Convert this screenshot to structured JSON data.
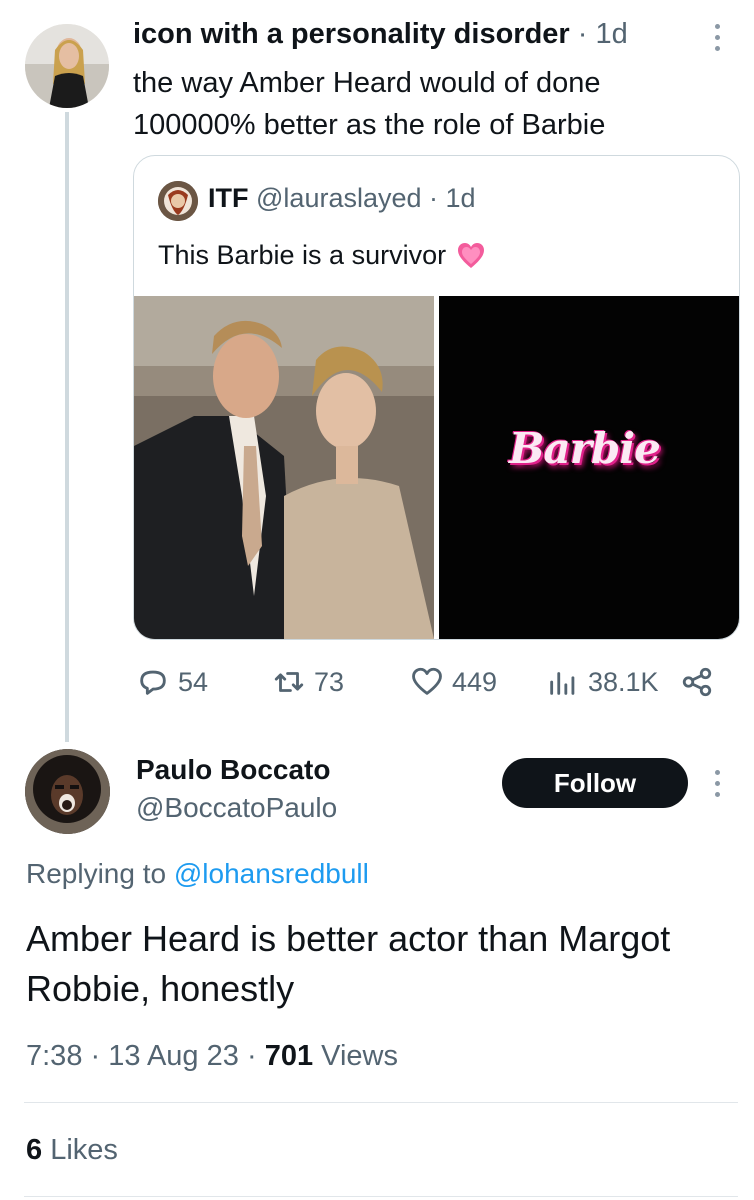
{
  "parent_tweet": {
    "display_name": "icon with a personality disorder",
    "time": "· 1d",
    "text_line1": "the way Amber Heard would of done",
    "text_line2": "100000% better as the role of Barbie"
  },
  "quoted_tweet": {
    "name": "ITF",
    "handle": "@lauraslayed",
    "time": "· 1d",
    "text": "This Barbie is a survivor",
    "emoji_icon": "growing-heart-icon",
    "logo_text": "Barbie"
  },
  "actions": {
    "replies": "54",
    "retweets": "73",
    "likes": "449",
    "views": "38.1K"
  },
  "reply_tweet": {
    "display_name": "Paulo Boccato",
    "handle": "@BoccatoPaulo",
    "follow_label": "Follow",
    "replying_prefix": "Replying to",
    "replying_handle": "@lohansredbull",
    "text_line1": "Amber Heard is better actor than Margot",
    "text_line2": "Robbie, honestly",
    "time": "7:38",
    "date": "13 Aug 23",
    "views_count": "701",
    "views_label": "Views",
    "likes_count": "6",
    "likes_label": "Likes"
  },
  "colors": {
    "accent": "#1d9bf0",
    "text": "#0f1419",
    "muted": "#536471",
    "barbie_pink": "#e0218a"
  }
}
